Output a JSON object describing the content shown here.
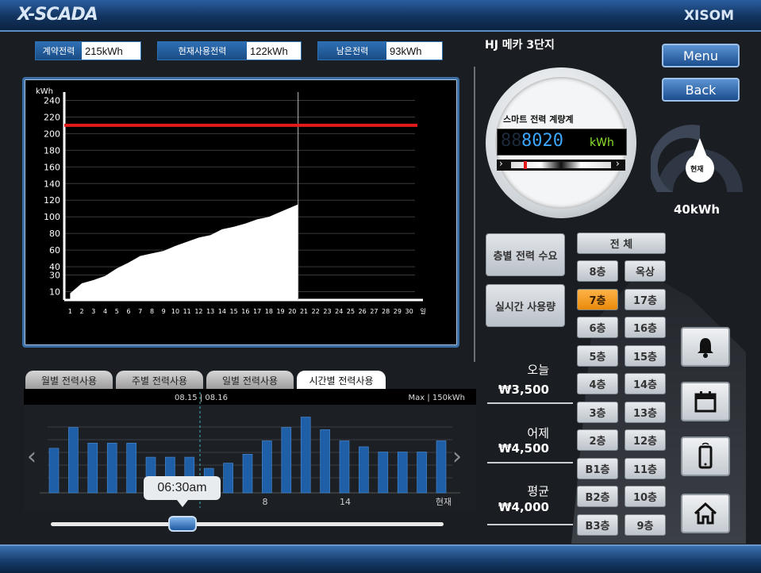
{
  "titlebar": {
    "brand": "X-SCADA",
    "brand_right": "XISOM"
  },
  "summary": [
    {
      "label": "계약전력",
      "value": "215kWh"
    },
    {
      "label": "현재사용전력",
      "value": "122kWh"
    },
    {
      "label": "남은전력",
      "value": "93kWh"
    }
  ],
  "site_name": "HJ 메카 3단지",
  "nav": {
    "menu_label": "Menu",
    "back_label": "Back"
  },
  "meter": {
    "title": "스마트 전력 계량계",
    "reading": "8020",
    "unit": "kWh"
  },
  "gauge": {
    "label": "현재",
    "value": "40kWh"
  },
  "colors": {
    "accent": "#2e6fb4",
    "limit_line": "#e11b1b",
    "active_floor": "#f5a623",
    "bar": "#1f5fa8"
  },
  "chart_data": [
    {
      "type": "area",
      "ylabel": "kWh",
      "ylim": [
        0,
        250
      ],
      "yticks": [
        10,
        30,
        40,
        60,
        80,
        100,
        120,
        140,
        160,
        180,
        200,
        220,
        240
      ],
      "x": [
        1,
        2,
        3,
        4,
        5,
        6,
        7,
        8,
        9,
        10,
        11,
        12,
        13,
        14,
        15,
        16,
        17,
        18,
        19,
        20,
        21,
        22,
        23,
        24,
        25,
        26,
        27,
        28,
        29,
        30
      ],
      "xlabel_suffix": "일",
      "series": [
        {
          "values": [
            8,
            20,
            24,
            29,
            38,
            45,
            53,
            56,
            59,
            65,
            70,
            75,
            78,
            85,
            88,
            92,
            97,
            100,
            106,
            112
          ]
        }
      ],
      "limit_value": 210,
      "current_day": 20
    },
    {
      "type": "bar",
      "header_left": "08.15 | 08.16",
      "header_right": "Max | 150kWh",
      "tick_labels": [
        "8",
        "14",
        "현재"
      ],
      "values": [
        60,
        88,
        67,
        67,
        67,
        48,
        48,
        48,
        33,
        40,
        52,
        70,
        88,
        102,
        85,
        70,
        62,
        55,
        55,
        55,
        70
      ]
    }
  ],
  "tabs": [
    "월별 전력사용",
    "주별 전력사용",
    "일별 전력사용",
    "시간별 전력사용"
  ],
  "active_tab": 3,
  "slider": {
    "time": "06:30am"
  },
  "side_buttons": {
    "floor_demand": "층별 전력 수요",
    "realtime_usage": "실시간 사용량"
  },
  "floors": {
    "all": "전 체",
    "left": [
      "8층",
      "7층",
      "6층",
      "5층",
      "4층",
      "3층",
      "2층",
      "B1층",
      "B2층",
      "B3층"
    ],
    "right": [
      "옥상",
      "17층",
      "16층",
      "15층",
      "14층",
      "13층",
      "12층",
      "11층",
      "10층",
      "9층"
    ],
    "active": "7층"
  },
  "stats": [
    {
      "label": "오늘",
      "value": "₩3,500"
    },
    {
      "label": "어제",
      "value": "₩4,500"
    },
    {
      "label": "평균",
      "value": "₩4,000"
    }
  ],
  "icons": [
    "bell-icon",
    "calendar-icon",
    "phone-icon",
    "home-icon"
  ]
}
